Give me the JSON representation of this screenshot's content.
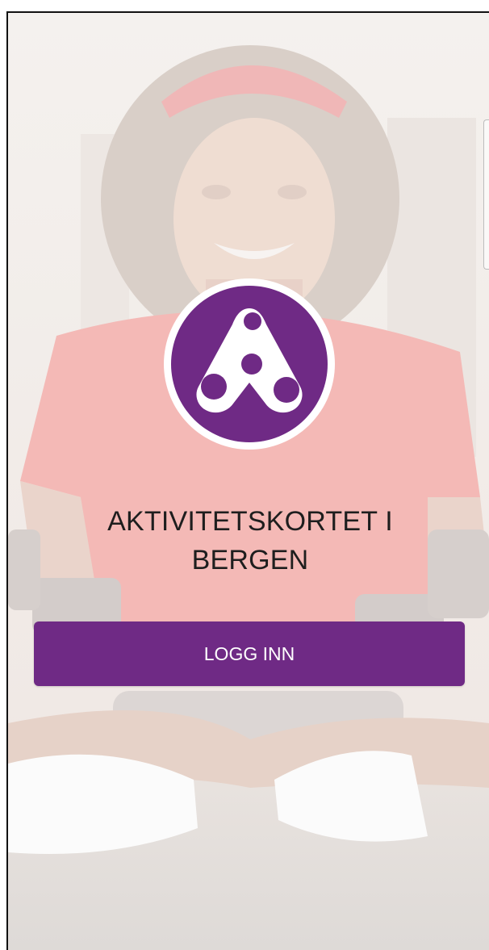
{
  "app": {
    "title_lines": [
      "AKTIVITETSKORTET I",
      "BERGEN"
    ]
  },
  "login": {
    "button_label": "LOGG INN"
  },
  "logo": {
    "icon": "aktivitetskortet-logo-icon"
  },
  "background": {
    "description_icon": "photo-child-on-skates"
  },
  "colors": {
    "brand_purple": "#6f2a85",
    "button_text": "#ffffff",
    "title_text": "#1e1e1e"
  }
}
